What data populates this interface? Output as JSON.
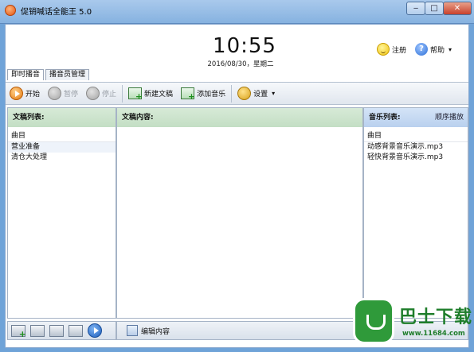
{
  "window": {
    "title": "促销喊话全能王 5.0",
    "min_label": "‒",
    "max_label": "□",
    "close_label": "✕"
  },
  "clock": {
    "time": "10:55",
    "date": "2016/08/30，星期二"
  },
  "top_links": {
    "register": "注册",
    "help": "帮助",
    "help_glyph": "?"
  },
  "tabs": [
    {
      "label": "即时播音",
      "active": true
    },
    {
      "label": "播音员管理",
      "active": false
    }
  ],
  "toolbar": {
    "start": "开始",
    "pause": "暂停",
    "stop": "停止",
    "new_script": "新建文稿",
    "add_music": "添加音乐",
    "settings": "设置"
  },
  "left_panel": {
    "header": "文稿列表:",
    "column": "曲目",
    "items": [
      "营业准备",
      "清仓大处理"
    ]
  },
  "middle_panel": {
    "header": "文稿内容:"
  },
  "right_panel": {
    "header": "音乐列表:",
    "play_mode": "顺序播放",
    "column": "曲目",
    "items": [
      "动感背景音乐演示.mp3",
      "轻快背景音乐演示.mp3"
    ]
  },
  "bottom_bar": {
    "edit_label": "编辑内容"
  },
  "watermark": {
    "brand": "巴士下载",
    "url": "www.11684.com"
  },
  "colors": {
    "accent": "#e57b10",
    "panel_header_green": "#c3dec4",
    "panel_header_blue": "#b9d0ee",
    "titlebar": "#86b2e0"
  },
  "icons": {
    "app": "app-icon",
    "register": "smile-icon",
    "help": "help-icon",
    "start": "play-icon",
    "pause": "pause-icon",
    "stop": "stop-icon",
    "new_script": "new-doc-icon",
    "add_music": "add-music-icon",
    "settings": "gear-icon"
  }
}
